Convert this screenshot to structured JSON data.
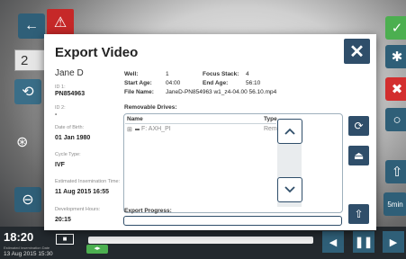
{
  "background": {
    "left_value": "2",
    "time": "18:20",
    "time_label": "Estimated Insemination Date",
    "date": "13 Aug 2015 15:30",
    "right_btn_label": "5min",
    "colors": {
      "green": "#4caf50",
      "red": "#d32f2f",
      "blue": "#2f5f78",
      "alert": "#d32f2f"
    }
  },
  "modal": {
    "title": "Export Video",
    "close_label": "✕"
  },
  "patient": {
    "name": "Jane D",
    "id1_label": "ID 1:",
    "id1": "PN854963",
    "id2_label": "ID 2:",
    "id2": "-",
    "dob_label": "Date of Birth:",
    "dob": "01 Jan 1980",
    "cycle_label": "Cycle Type:",
    "cycle": "IVF",
    "insem_label": "Estimated Insemination Time:",
    "insem": "11 Aug 2015 16:55",
    "dev_label": "Development Hours:",
    "dev": "20:15"
  },
  "video": {
    "well_label": "Well:",
    "well": "1",
    "focus_label": "Focus Stack:",
    "focus": "4",
    "start_label": "Start Age:",
    "start": "04:00",
    "end_label": "End Age:",
    "end": "56:10",
    "file_label": "File Name:",
    "file": "JaneD-PN854963 w1_z4-04.00 56.10.mp4"
  },
  "drives": {
    "title": "Removable Drives:",
    "col_name": "Name",
    "col_type": "Type",
    "rows": [
      {
        "expander": "⊞",
        "name": "F: AXH_PI",
        "type": "Removable"
      }
    ]
  },
  "progress": {
    "label": "Export Progress:",
    "value": 0
  }
}
